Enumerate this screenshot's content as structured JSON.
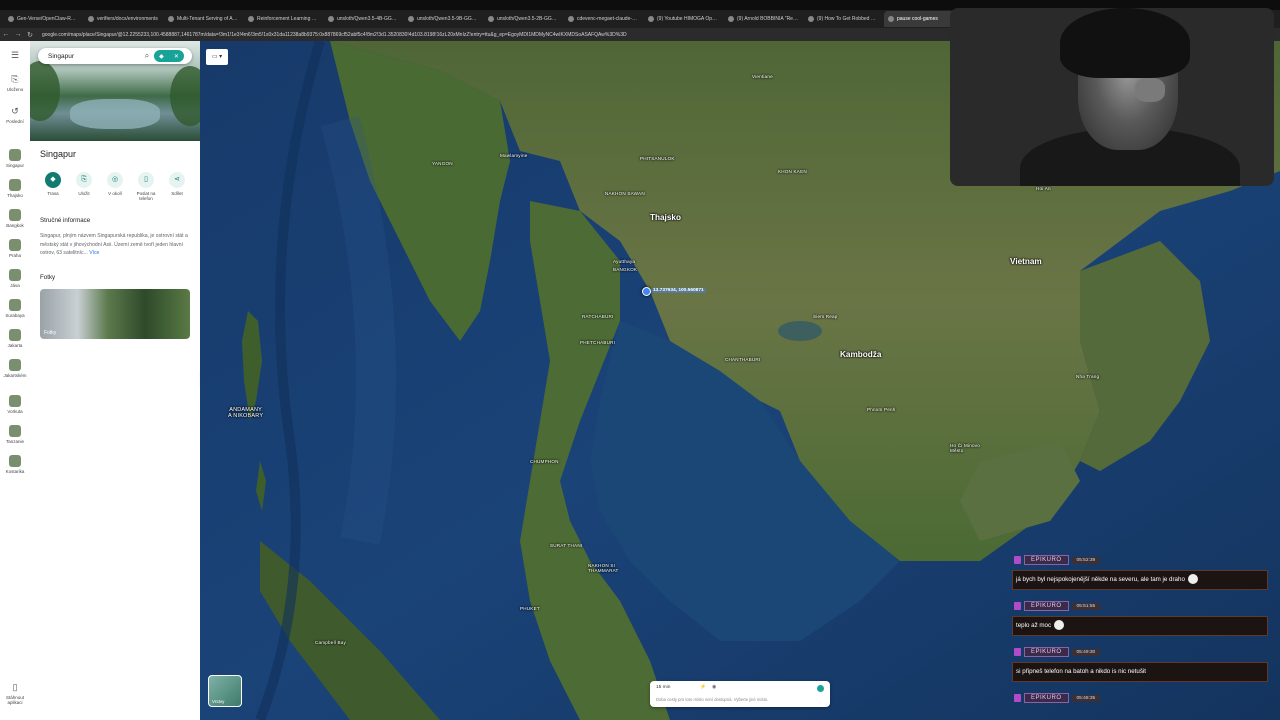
{
  "browser": {
    "tabs": [
      {
        "label": "Gen-Verse/OpenClaw-RL: Open",
        "active": false
      },
      {
        "label": "verifiers/docs/environments",
        "active": false
      },
      {
        "label": "Multi-Tenant Serving of Adapt",
        "active": false
      },
      {
        "label": "Reinforcement Learning (RL) fo",
        "active": false
      },
      {
        "label": "unsloth/Qwen3.5-4B-GGUF",
        "active": false
      },
      {
        "label": "unsloth/Qwen3.5-9B-GGUF",
        "active": false
      },
      {
        "label": "unsloth/Qwen3.5-2B-GGUF",
        "active": false
      },
      {
        "label": "cdevenc-megaet-claude-code",
        "active": false
      },
      {
        "label": "(9) Youtube HIMOGA Opening",
        "active": false
      },
      {
        "label": "(9) Arnold BOBBINIA \"Recom",
        "active": false
      },
      {
        "label": "(9) How To Get Robbed By Mo",
        "active": false
      },
      {
        "label": "pause cool-games",
        "active": true
      }
    ],
    "url": "google.com/maps/place/Singapur/@12.2255233,100.4588887,1461787m/data=!3m1!1e3!4m6!3m5!1s0x31da11238a8b9375:0x887869cf52abf5c4!8m2!3d1.3520830!4d103.8198!16zL20xMnIzZ!entry=ttu&g_ep=EgoyMDI1MDMyNC4wIKXMDSoASAFQAw%3D%3D"
  },
  "rail": [
    {
      "label": "",
      "icon": "menu-icon"
    },
    {
      "label": "Uloženo",
      "icon": "bookmark-icon"
    },
    {
      "label": "Poslední",
      "icon": "history-icon"
    },
    {
      "label": "Singapur",
      "icon": "thumb"
    },
    {
      "label": "Thajsko",
      "icon": "thumb"
    },
    {
      "label": "Bangkok",
      "icon": "thumb"
    },
    {
      "label": "Praha",
      "icon": "thumb"
    },
    {
      "label": "Jáva",
      "icon": "thumb"
    },
    {
      "label": "Surabaya",
      "icon": "thumb"
    },
    {
      "label": "Jakarta",
      "icon": "thumb"
    },
    {
      "label": "Jakartském",
      "icon": "thumb"
    },
    {
      "label": "Vorkuta",
      "icon": "thumb"
    },
    {
      "label": "Tanzanie",
      "icon": "thumb"
    },
    {
      "label": "Kostarika",
      "icon": "thumb"
    },
    {
      "label": "Stáhnout aplikaci",
      "icon": "phone-icon"
    }
  ],
  "panel": {
    "search_value": "Singapur",
    "place_title": "Singapur",
    "actions": [
      {
        "label": "Trasa",
        "icon": "directions-icon"
      },
      {
        "label": "Uložit",
        "icon": "bookmark-icon"
      },
      {
        "label": "V okolí",
        "icon": "nearby-icon"
      },
      {
        "label": "Poslat na telefon",
        "icon": "phone-icon"
      },
      {
        "label": "Sdílet",
        "icon": "share-icon"
      }
    ],
    "summary_heading": "Stručné informace",
    "summary_text": "Singapur, plným názvem Singapurská republika, je ostrovní stát a městský stát v jihovýchodní Asii. Území země tvoří jeden hlavní ostrov, 63 satelitníc...",
    "more_label": "Více",
    "photos_heading": "Fotky",
    "photos_label": "Fotky"
  },
  "map": {
    "pin_coords": "13.737634, 100.560871",
    "labels": {
      "thajsko": "Thajsko",
      "vietnam": "Vietnam",
      "kambodza": "Kambodža",
      "vientiane": "Vientiane",
      "mawlamyine": "Mawlamyine",
      "ayutthaya": "Ayutthaya",
      "bangkok": "BANGKOK",
      "siem_reap": "Siem Reap",
      "phnom_penh": "Phnom Penh",
      "ho_chi_minh": "Ho Či Minovo\nMěsto",
      "hoi_an": "Hoi An",
      "nha_trang": "Nha Trang",
      "andaman": "ANDAMANY\nA NIKOBARY",
      "chumphon": "CHUMPHON",
      "surat_thani": "SURAT THANI",
      "nakhon": "NAKHON SI\nTHAMMARAT",
      "phuket": "PHUKET",
      "campbell": "Campbell Bay",
      "phetchaburi": "PHETCHABURI",
      "ratchaburi": "RATCHABURI",
      "chanthaburi": "CHANTHABURI",
      "yangon": "YANGON",
      "khon_kaen": "KHON KAEN",
      "nakhon_sawan": "NAKHON SAWAN",
      "phitsanulok": "PHITSANULOK"
    },
    "layers_label": "Vrstvy",
    "travel": {
      "time": "15 min",
      "note": "Doba cesty pro toto místo není dostupná. Vyberte jiné místo."
    }
  },
  "chat": [
    {
      "user": "EPIKURO",
      "time": "05:52:39",
      "text": "já bych byl nejspokojenější někde na severu, ale tam je draho"
    },
    {
      "user": "EPIKURO",
      "time": "05:51:55",
      "text": "teplo až moc"
    },
    {
      "user": "EPIKURO",
      "time": "05:49:30",
      "text": "si připneš telefon na batoh a nikdo is nic netušit"
    },
    {
      "user": "EPIKURO",
      "time": "05:48:35",
      "text": ""
    }
  ],
  "colors": {
    "accent": "#17a398",
    "chat_border": "#5e3a2d",
    "badge": "#b14bc9"
  }
}
